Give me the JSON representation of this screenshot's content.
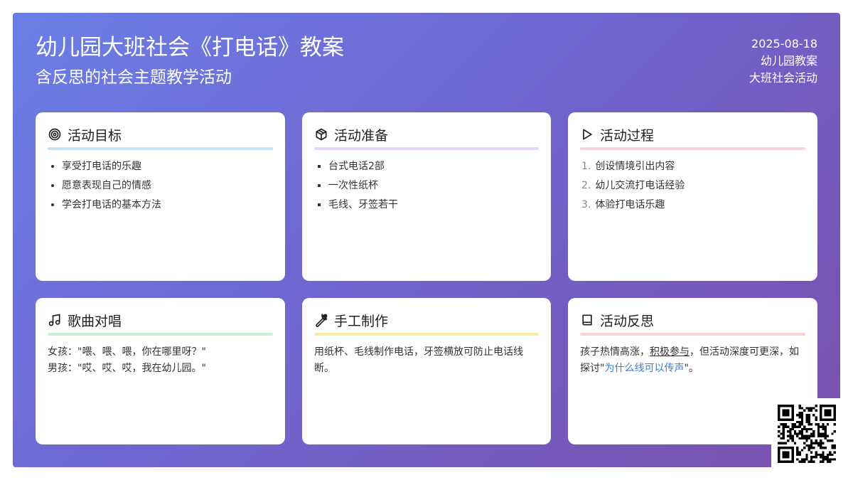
{
  "header": {
    "title": "幼儿园大班社会《打电话》教案",
    "subtitle": "含反思的社会主题教学活动",
    "date": "2025-08-18",
    "tag1": "幼儿园教案",
    "tag2": "大班社会活动"
  },
  "cards": {
    "goals": {
      "icon": "target-icon",
      "title": "活动目标",
      "items": [
        "享受打电话的乐趣",
        "愿意表现自己的情感",
        "学会打电话的基本方法"
      ]
    },
    "prep": {
      "icon": "box-icon",
      "title": "活动准备",
      "items": [
        "台式电话2部",
        "一次性纸杯",
        "毛线、牙签若干"
      ]
    },
    "process": {
      "icon": "play-icon",
      "title": "活动过程",
      "nums": [
        "1.",
        "2.",
        "3."
      ],
      "items": [
        "创设情境引出内容",
        "幼儿交流打电话经验",
        "体验打电话乐趣"
      ]
    },
    "song": {
      "icon": "music-note-icon",
      "title": "歌曲对唱",
      "line1": "女孩：\"喂、喂、喂，你在哪里呀？\"",
      "line2": "男孩：\"哎、哎、哎，我在幼儿园。\""
    },
    "craft": {
      "icon": "wrench-icon",
      "title": "手工制作",
      "text": "用纸杯、毛线制作电话，牙签横放可防止电话线断。"
    },
    "reflection": {
      "icon": "book-icon",
      "title": "活动反思",
      "part1": "孩子热情高涨，",
      "highlight1": "积极参与",
      "part2": "，但活动深度可更深，如探讨\"",
      "highlight2": "为什么线可以传声",
      "part3": "\"。"
    }
  },
  "qr": {
    "icon": "qr-code-icon"
  },
  "colors": {
    "gradient_start": "#6a7fe6",
    "gradient_end": "#7a4fae",
    "link_blue": "#3d7fd1"
  }
}
